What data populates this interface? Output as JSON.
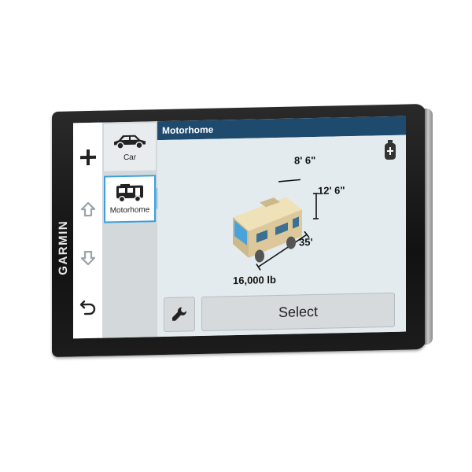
{
  "device": {
    "brand": "GARMIN"
  },
  "controls": {
    "add_icon": "plus-icon",
    "up_icon": "arrow-up-icon",
    "down_icon": "arrow-down-icon",
    "back_icon": "back-icon"
  },
  "vehicles": [
    {
      "label": "Car",
      "icon": "car-icon",
      "selected": false
    },
    {
      "label": "Motorhome",
      "icon": "motorhome-icon",
      "selected": true
    }
  ],
  "header": {
    "title": "Motorhome"
  },
  "dimensions": {
    "width": "8' 6\"",
    "height": "12' 6\"",
    "length": "35'",
    "weight": "16,000  lb"
  },
  "actions": {
    "settings_icon": "wrench-icon",
    "select_label": "Select",
    "propane_icon": "propane-tank-icon"
  },
  "colors": {
    "header_bg": "#1e4a6e",
    "selection": "#3aa0dc",
    "screen_bg": "#e4ebef"
  }
}
